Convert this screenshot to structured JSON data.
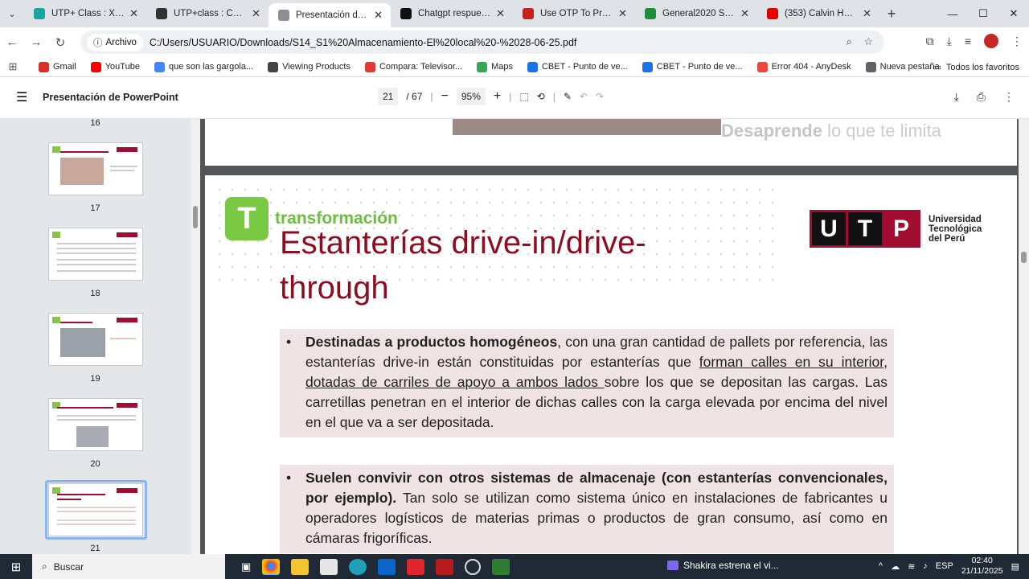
{
  "browser": {
    "tabs": [
      {
        "label": "UTP+ Class : Xpedition",
        "color": "#1aa3a3"
      },
      {
        "label": "UTP+class : Contenido",
        "color": "#333333"
      },
      {
        "label": "Presentación de PowerPoint",
        "color": "#8a8f96"
      },
      {
        "label": "Chatgpt respuesta a",
        "color": "#111111"
      },
      {
        "label": "Use OTP To Proceed",
        "color": "#c5221f"
      },
      {
        "label": "General2020 Stream",
        "color": "#1e8e3e"
      },
      {
        "label": "(353) Calvin Harris - ",
        "color": "#e00000"
      }
    ],
    "new_tab": "+",
    "window": {
      "minimize": "—",
      "maximize": "☐",
      "close": "✕"
    },
    "chip_label": "Archivo",
    "url": "C:/Users/USUARIO/Downloads/S14_S1%20Almacenamiento-El%20local%20-%2028-06-25.pdf",
    "bookmarks": [
      {
        "label": "Gmail",
        "color": "#d93025"
      },
      {
        "label": "YouTube",
        "color": "#ff0000"
      },
      {
        "label": "que son las gargola...",
        "color": "#4285f4"
      },
      {
        "label": "Viewing Products",
        "color": "#444444"
      },
      {
        "label": "Compara: Televisor...",
        "color": "#e53935"
      },
      {
        "label": "Maps",
        "color": "#34a853"
      },
      {
        "label": "CBET - Punto de ve...",
        "color": "#1a73e8"
      },
      {
        "label": "CBET - Punto de ve...",
        "color": "#1a73e8"
      },
      {
        "label": "Error 404 - AnyDesk",
        "color": "#ef443b"
      },
      {
        "label": "Nueva pestaña",
        "color": "#5f6368"
      }
    ],
    "all_bookmarks": "Todos los favoritos"
  },
  "pdf": {
    "title": "Presentación de PowerPoint",
    "page_current": "21",
    "page_total": "/ 67",
    "zoom": "95%",
    "thumbnails": [
      {
        "number": "16"
      },
      {
        "number": "17"
      },
      {
        "number": "18"
      },
      {
        "number": "19"
      },
      {
        "number": "20"
      },
      {
        "number": "21"
      }
    ]
  },
  "slide": {
    "prev_tagline_bold": "Desaprende",
    "prev_tagline_rest": " lo que te limita",
    "brand": "transformación",
    "brand_letter": "T",
    "utp_letters": [
      "U",
      "T",
      "P"
    ],
    "utp_name_1": "Universidad",
    "utp_name_2": "Tecnológica",
    "utp_name_3": "del Perú",
    "title_line1": "Estanterías drive-in/drive-",
    "title_line2": "through",
    "bullet1_bold": "Destinadas a productos homogéneos",
    "bullet1_a": ", con una gran cantidad de pallets por referencia, las estanterías drive-in están constituidas por estanterías que ",
    "bullet1_u": "forman calles en su interior, dotadas de carriles de apoyo a ambos lados ",
    "bullet1_b": "sobre los que se depositan las cargas. Las carretillas penetran en el interior de dichas calles con la carga elevada por encima del nivel en el que va a ser depositada.",
    "bullet2_bold": "Suelen convivir con otros sistemas de almacenaje (con estanterías convencionales, por ejemplo).",
    "bullet2_rest": " Tan solo se utilizan como sistema único en instalaciones de fabricantes u operadores logísticos de materias primas o productos de gran consumo, así como en cámaras frigoríficas."
  },
  "taskbar": {
    "search": "Buscar",
    "news": "Shakira estrena el vi...",
    "lang": "ESP",
    "time": "02:40",
    "date": "21/11/2025"
  }
}
